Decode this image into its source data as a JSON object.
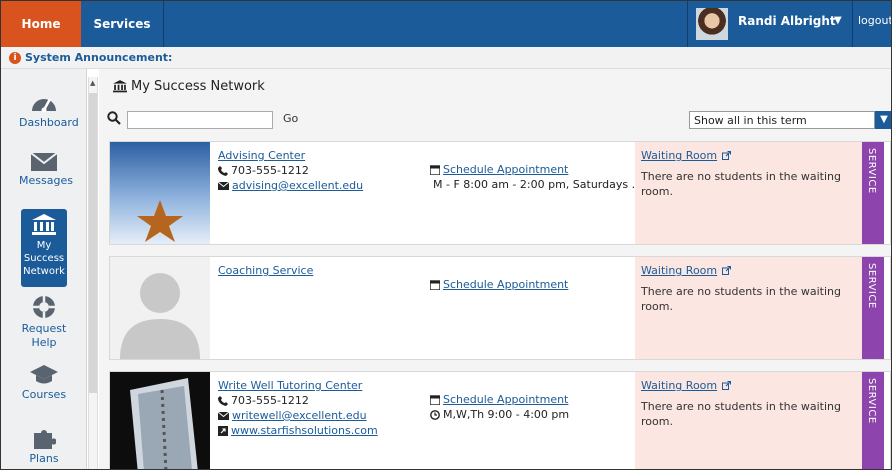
{
  "nav": {
    "home": "Home",
    "services": "Services",
    "user_name": "Randi Albright",
    "logout": "logout"
  },
  "announcement": "System Announcement:",
  "sidebar": {
    "items": [
      {
        "label": "Dashboard",
        "icon": "dashboard-icon"
      },
      {
        "label": "Messages",
        "icon": "envelope-icon"
      },
      {
        "label": "My Success Network",
        "icon": "institution-icon",
        "active": true
      },
      {
        "label": "Request Help",
        "icon": "life-ring-icon"
      },
      {
        "label": "Courses",
        "icon": "graduation-cap-icon"
      },
      {
        "label": "Plans",
        "icon": "puzzle-icon"
      }
    ]
  },
  "main": {
    "title": "My Success Network",
    "search_value": "",
    "go_label": "Go",
    "filter_value": "Show all in this term"
  },
  "cards": [
    {
      "name": "Advising Center",
      "phone": "703-555-1212",
      "email": "advising@excellent.edu",
      "website": "",
      "schedule_label": "Schedule Appointment",
      "hours": "M - F 8:00 am - 2:00 pm, Saturdays ...",
      "waiting_room": "Waiting Room",
      "waiting_msg": "There are no students in the waiting room.",
      "tag": "SERVICE"
    },
    {
      "name": "Coaching Service",
      "phone": "",
      "email": "",
      "website": "",
      "schedule_label": "Schedule Appointment",
      "hours": "",
      "waiting_room": "Waiting Room",
      "waiting_msg": "There are no students in the waiting room.",
      "tag": "SERVICE"
    },
    {
      "name": "Write Well Tutoring Center",
      "phone": "703-555-1212",
      "email": "writewell@excellent.edu",
      "website": "www.starfishsolutions.com",
      "schedule_label": "Schedule Appointment",
      "hours": "M,W,Th 9:00 - 4:00 pm",
      "waiting_room": "Waiting Room",
      "waiting_msg": "There are no students in the waiting room.",
      "tag": "SERVICE"
    }
  ]
}
